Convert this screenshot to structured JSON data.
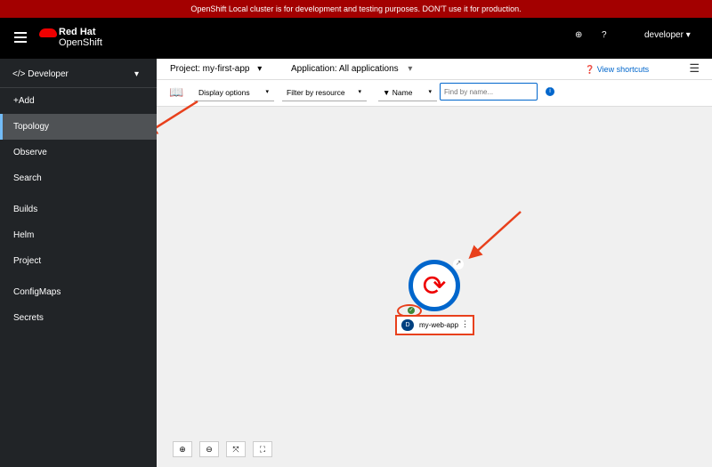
{
  "banner": "OpenShift Local cluster is for development and testing purposes. DON'T use it for production.",
  "brand": {
    "line1": "Red Hat",
    "line2": "OpenShift"
  },
  "masthead": {
    "user": "developer"
  },
  "sidebar": {
    "perspective": "Developer",
    "items": [
      "+Add",
      "Topology",
      "Observe",
      "Search",
      "Builds",
      "Helm",
      "Project",
      "ConfigMaps",
      "Secrets"
    ]
  },
  "toolbar": {
    "project": "Project: my-first-app",
    "application": "Application: All applications",
    "shortcuts": "View shortcuts",
    "display_options": "Display options",
    "filter_resource": "Filter by resource",
    "name_filter": "Name",
    "search_placeholder": "Find by name..."
  },
  "node": {
    "badge": "D",
    "name": "my-web-app"
  },
  "colors": {
    "accent": "#0066cc",
    "banner": "#a30000",
    "annotation": "#e8401c"
  }
}
